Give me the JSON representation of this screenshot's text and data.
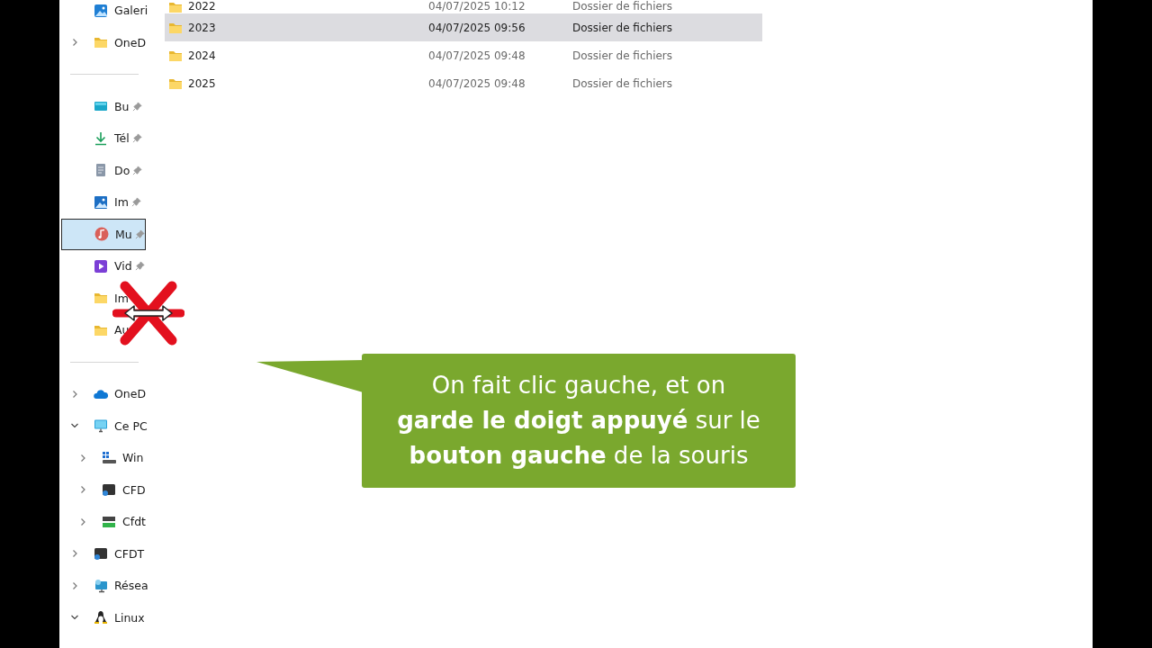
{
  "sidebar": {
    "groups": [
      {
        "items": [
          {
            "label": "Galeri",
            "kind": "gallery"
          },
          {
            "label": "OneD",
            "kind": "folder",
            "expanded": false
          }
        ]
      },
      {
        "items": [
          {
            "label": "Bu",
            "kind": "desktop",
            "pinned": true,
            "selected": false
          },
          {
            "label": "Tél",
            "kind": "download",
            "pinned": true,
            "selected": false
          },
          {
            "label": "Do",
            "kind": "document",
            "pinned": true,
            "selected": false
          },
          {
            "label": "Im",
            "kind": "image",
            "pinned": true,
            "selected": false
          },
          {
            "label": "Mu",
            "kind": "music",
            "pinned": true,
            "selected": true
          },
          {
            "label": "Vid",
            "kind": "video",
            "pinned": true,
            "selected": false
          },
          {
            "label": "Im",
            "kind": "folder",
            "pinned": false,
            "selected": false
          },
          {
            "label": "Au",
            "kind": "folder",
            "pinned": false,
            "selected": false
          }
        ]
      },
      {
        "items": [
          {
            "label": "OneD",
            "kind": "cloud",
            "expanded": false
          },
          {
            "label": "Ce PC",
            "kind": "pc",
            "expanded": true,
            "children": [
              {
                "label": "Win",
                "kind": "windrive",
                "expanded": false
              },
              {
                "label": "CFD",
                "kind": "drive",
                "expanded": false
              },
              {
                "label": "Cfdt",
                "kind": "greendrive",
                "expanded": false
              }
            ]
          },
          {
            "label": "CFDT",
            "kind": "drive",
            "expanded": false
          },
          {
            "label": "Résea",
            "kind": "network",
            "expanded": false
          },
          {
            "label": "Linux",
            "kind": "linux",
            "expanded": true
          }
        ]
      }
    ]
  },
  "files": [
    {
      "name": "2022",
      "modified": "04/07/2025 10:12",
      "type": "Dossier de fichiers",
      "selected": false
    },
    {
      "name": "2023",
      "modified": "04/07/2025 09:56",
      "type": "Dossier de fichiers",
      "selected": true
    },
    {
      "name": "2024",
      "modified": "04/07/2025 09:48",
      "type": "Dossier de fichiers",
      "selected": false
    },
    {
      "name": "2025",
      "modified": "04/07/2025 09:48",
      "type": "Dossier de fichiers",
      "selected": false
    }
  ],
  "callout": {
    "lines": [
      "On fait clic gauche, et on",
      "**garde le doigt appuyé** sur le",
      "**bouton gauche** de la souris"
    ]
  }
}
